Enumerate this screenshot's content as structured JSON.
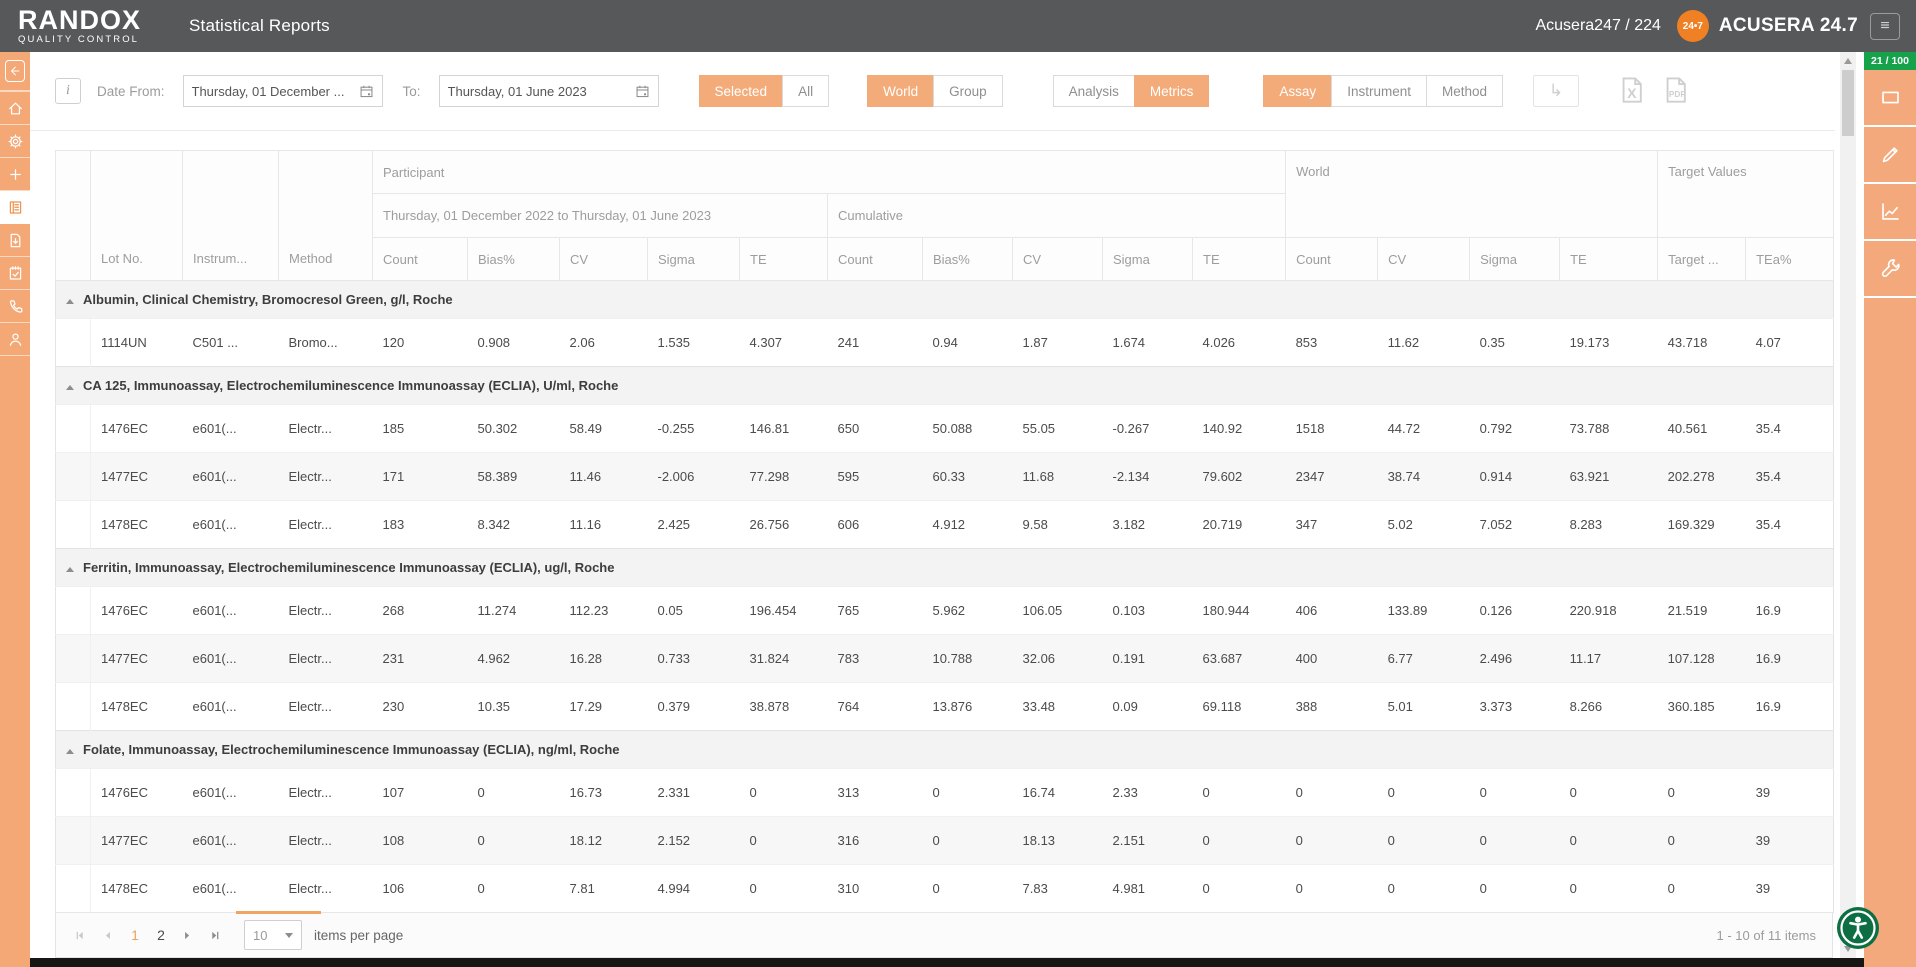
{
  "header": {
    "logo_line1": "RANDOX",
    "logo_line2": "QUALITY CONTROL",
    "title": "Statistical Reports",
    "account": "Acusera247 / 224",
    "badge": "24•7",
    "brand": "ACUSERA 24.7"
  },
  "sidebar": {
    "items": [
      {
        "name": "back",
        "icon": "back-arrow-icon",
        "active": false
      },
      {
        "name": "home",
        "icon": "home-icon",
        "active": false
      },
      {
        "name": "settings",
        "icon": "gear-icon",
        "active": false
      },
      {
        "name": "add",
        "icon": "plus-icon",
        "active": false
      },
      {
        "name": "reports",
        "icon": "report-icon",
        "active": true
      },
      {
        "name": "downloads",
        "icon": "file-download-icon",
        "active": false
      },
      {
        "name": "tasks",
        "icon": "clipboard-check-icon",
        "active": false
      },
      {
        "name": "contact",
        "icon": "phone-icon",
        "active": false
      },
      {
        "name": "profile",
        "icon": "user-icon",
        "active": false
      }
    ]
  },
  "toolbar": {
    "info_label": "i",
    "date_from_label": "Date From:",
    "date_from_value": "Thursday, 01 December ...",
    "to_label": "To:",
    "date_to_value": "Thursday, 01 June 2023",
    "redo_glyph": "↳",
    "toggles": [
      {
        "options": [
          {
            "label": "Selected",
            "active": true
          },
          {
            "label": "All",
            "active": false
          }
        ]
      },
      {
        "options": [
          {
            "label": "World",
            "active": true
          },
          {
            "label": "Group",
            "active": false
          }
        ]
      },
      {
        "options": [
          {
            "label": "Analysis",
            "active": false
          },
          {
            "label": "Metrics",
            "active": true
          }
        ]
      },
      {
        "options": [
          {
            "label": "Assay",
            "active": true
          },
          {
            "label": "Instrument",
            "active": false
          },
          {
            "label": "Method",
            "active": false
          }
        ]
      }
    ]
  },
  "table": {
    "columns": {
      "fixed": [
        "Lot No.",
        "Instrum...",
        "Method"
      ],
      "participant_label": "Participant",
      "date_range_label": "Thursday, 01 December 2022 to Thursday, 01 June 2023",
      "cumulative_label": "Cumulative",
      "world_label": "World",
      "target_label": "Target Values",
      "range_cols": [
        "Count",
        "Bias%",
        "CV",
        "Sigma",
        "TE"
      ],
      "cumulative_cols": [
        "Count",
        "Bias%",
        "CV",
        "Sigma",
        "TE"
      ],
      "world_cols": [
        "Count",
        "CV",
        "Sigma",
        "TE"
      ],
      "target_cols": [
        "Target ...",
        "TEa%"
      ]
    },
    "groups": [
      {
        "title": "Albumin, Clinical Chemistry, Bromocresol Green, g/l, Roche",
        "rows": [
          [
            "1114UN",
            "C501 ...",
            "Bromo...",
            "120",
            "0.908",
            "2.06",
            "1.535",
            "4.307",
            "241",
            "0.94",
            "1.87",
            "1.674",
            "4.026",
            "853",
            "11.62",
            "0.35",
            "19.173",
            "43.718",
            "4.07"
          ]
        ]
      },
      {
        "title": "CA 125, Immunoassay, Electrochemiluminescence Immunoassay (ECLIA), U/ml, Roche",
        "rows": [
          [
            "1476EC",
            "e601(...",
            "Electr...",
            "185",
            "50.302",
            "58.49",
            "-0.255",
            "146.81",
            "650",
            "50.088",
            "55.05",
            "-0.267",
            "140.92",
            "1518",
            "44.72",
            "0.792",
            "73.788",
            "40.561",
            "35.4"
          ],
          [
            "1477EC",
            "e601(...",
            "Electr...",
            "171",
            "58.389",
            "11.46",
            "-2.006",
            "77.298",
            "595",
            "60.33",
            "11.68",
            "-2.134",
            "79.602",
            "2347",
            "38.74",
            "0.914",
            "63.921",
            "202.278",
            "35.4"
          ],
          [
            "1478EC",
            "e601(...",
            "Electr...",
            "183",
            "8.342",
            "11.16",
            "2.425",
            "26.756",
            "606",
            "4.912",
            "9.58",
            "3.182",
            "20.719",
            "347",
            "5.02",
            "7.052",
            "8.283",
            "169.329",
            "35.4"
          ]
        ]
      },
      {
        "title": "Ferritin, Immunoassay, Electrochemiluminescence Immunoassay (ECLIA), ug/l, Roche",
        "rows": [
          [
            "1476EC",
            "e601(...",
            "Electr...",
            "268",
            "11.274",
            "112.23",
            "0.05",
            "196.454",
            "765",
            "5.962",
            "106.05",
            "0.103",
            "180.944",
            "406",
            "133.89",
            "0.126",
            "220.918",
            "21.519",
            "16.9"
          ],
          [
            "1477EC",
            "e601(...",
            "Electr...",
            "231",
            "4.962",
            "16.28",
            "0.733",
            "31.824",
            "783",
            "10.788",
            "32.06",
            "0.191",
            "63.687",
            "400",
            "6.77",
            "2.496",
            "11.17",
            "107.128",
            "16.9"
          ],
          [
            "1478EC",
            "e601(...",
            "Electr...",
            "230",
            "10.35",
            "17.29",
            "0.379",
            "38.878",
            "764",
            "13.876",
            "33.48",
            "0.09",
            "69.118",
            "388",
            "5.01",
            "3.373",
            "8.266",
            "360.185",
            "16.9"
          ]
        ]
      },
      {
        "title": "Folate, Immunoassay, Electrochemiluminescence Immunoassay (ECLIA), ng/ml, Roche",
        "rows": [
          [
            "1476EC",
            "e601(...",
            "Electr...",
            "107",
            "0",
            "16.73",
            "2.331",
            "0",
            "313",
            "0",
            "16.74",
            "2.33",
            "0",
            "0",
            "0",
            "0",
            "0",
            "0",
            "39"
          ],
          [
            "1477EC",
            "e601(...",
            "Electr...",
            "108",
            "0",
            "18.12",
            "2.152",
            "0",
            "316",
            "0",
            "18.13",
            "2.151",
            "0",
            "0",
            "0",
            "0",
            "0",
            "0",
            "39"
          ],
          [
            "1478EC",
            "e601(...",
            "Electr...",
            "106",
            "0",
            "7.81",
            "4.994",
            "0",
            "310",
            "0",
            "7.83",
            "4.981",
            "0",
            "0",
            "0",
            "0",
            "0",
            "0",
            "39"
          ]
        ]
      }
    ]
  },
  "pager": {
    "pages": [
      "1",
      "2"
    ],
    "active_page": "1",
    "page_size": "10",
    "items_per_page_label": "items per page",
    "range_label": "1 - 10 of 11 items"
  },
  "right_panel": {
    "usage_badge": "21 / 100",
    "tools": [
      {
        "name": "capture",
        "icon": "rectangle-icon"
      },
      {
        "name": "annotate",
        "icon": "pencil-icon"
      },
      {
        "name": "analytics",
        "icon": "line-chart-icon"
      },
      {
        "name": "tools",
        "icon": "wrench-icon"
      }
    ]
  },
  "colors": {
    "accent_orange": "#f3a876",
    "badge_orange": "#ef8023",
    "topbar_gray": "#57585a",
    "usage_green": "#16a24b"
  }
}
